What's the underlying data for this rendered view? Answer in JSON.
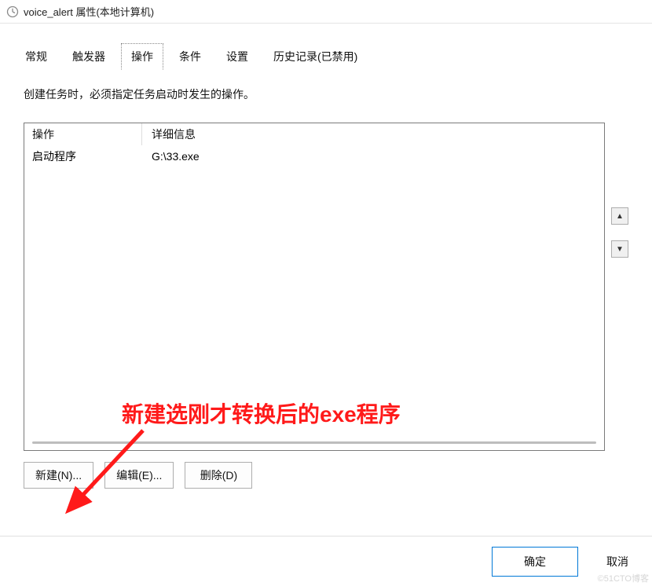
{
  "window": {
    "title": "voice_alert 属性(本地计算机)"
  },
  "tabs": {
    "items": [
      {
        "label": "常规"
      },
      {
        "label": "触发器"
      },
      {
        "label": "操作"
      },
      {
        "label": "条件"
      },
      {
        "label": "设置"
      },
      {
        "label": "历史记录(已禁用)"
      }
    ],
    "active_index": 2
  },
  "panel": {
    "instruction": "创建任务时，必须指定任务启动时发生的操作。",
    "columns": {
      "action": "操作",
      "detail": "详细信息"
    },
    "rows": [
      {
        "action": "启动程序",
        "detail": "G:\\33.exe"
      }
    ]
  },
  "side": {
    "up": "▲",
    "down": "▼"
  },
  "buttons": {
    "new": "新建(N)...",
    "edit": "编辑(E)...",
    "delete": "删除(D)"
  },
  "footer": {
    "ok": "确定",
    "cancel": "取消"
  },
  "annotation": {
    "text": "新建选刚才转换后的exe程序"
  },
  "watermark": "©51CTO博客"
}
